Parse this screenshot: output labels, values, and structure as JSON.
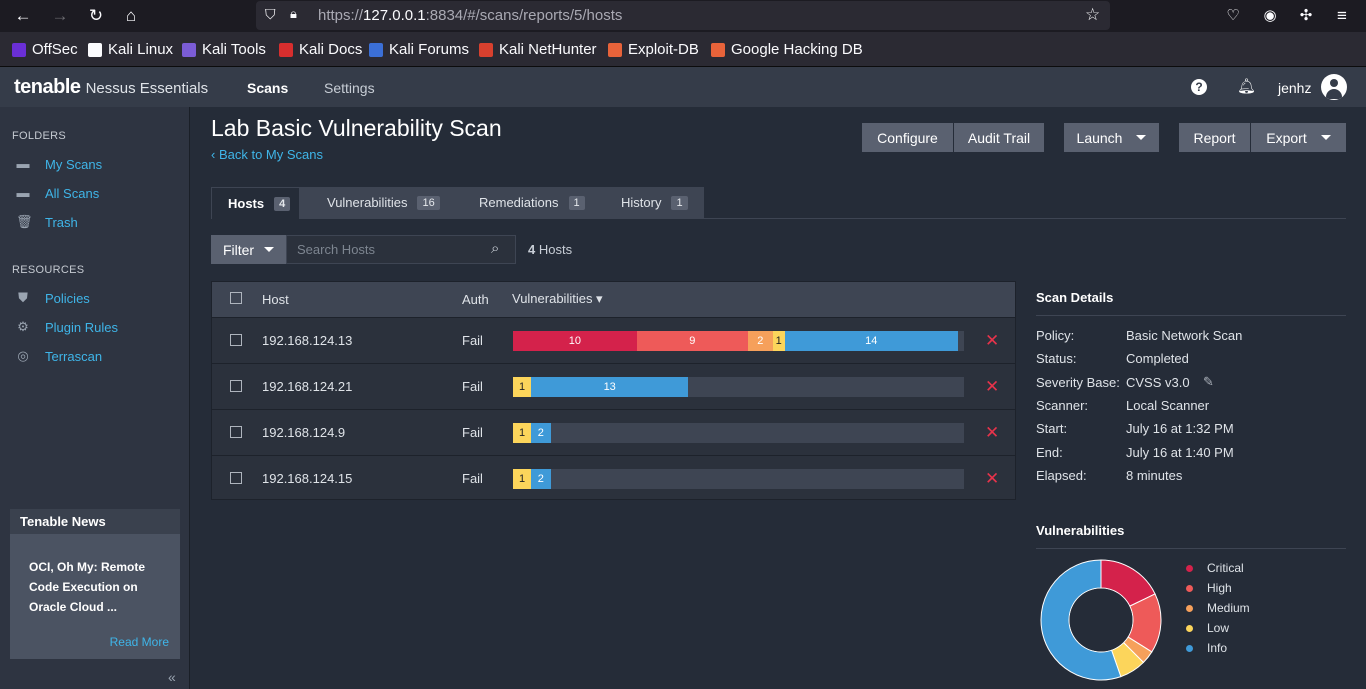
{
  "browser": {
    "url_prefix": "https://",
    "url_host": "127.0.0.1",
    "url_rest": ":8834/#/scans/reports/5/hosts"
  },
  "bookmarks": [
    {
      "label": "OffSec",
      "color": "#6a2fd6"
    },
    {
      "label": "Kali Linux",
      "color": "#fbfbfe"
    },
    {
      "label": "Kali Tools",
      "color": "#7b5cd6"
    },
    {
      "label": "Kali Docs",
      "color": "#d82e2e"
    },
    {
      "label": "Kali Forums",
      "color": "#3b6fd6"
    },
    {
      "label": "Kali NetHunter",
      "color": "#d8402e"
    },
    {
      "label": "Exploit-DB",
      "color": "#e8633a"
    },
    {
      "label": "Google Hacking DB",
      "color": "#e8633a"
    }
  ],
  "app": {
    "logo": "tenable",
    "product": "Nessus Essentials",
    "nav_scans": "Scans",
    "nav_settings": "Settings",
    "user": "jenhz"
  },
  "sidebar": {
    "folders_title": "FOLDERS",
    "folders": [
      {
        "label": "My Scans",
        "icon": "folder-icon"
      },
      {
        "label": "All Scans",
        "icon": "folder-icon"
      },
      {
        "label": "Trash",
        "icon": "trash-icon"
      }
    ],
    "resources_title": "RESOURCES",
    "resources": [
      {
        "label": "Policies",
        "icon": "shield-icon"
      },
      {
        "label": "Plugin Rules",
        "icon": "plugin-icon"
      },
      {
        "label": "Terrascan",
        "icon": "radar-icon"
      }
    ],
    "news_title": "Tenable News",
    "news_headline": "OCI, Oh My: Remote Code Execution on Oracle Cloud ...",
    "read_more": "Read More"
  },
  "scan": {
    "title": "Lab Basic Vulnerability Scan",
    "back_link": "Back to My Scans",
    "buttons": {
      "configure": "Configure",
      "audit_trail": "Audit Trail",
      "launch": "Launch",
      "report": "Report",
      "export": "Export"
    },
    "tabs": [
      {
        "label": "Hosts",
        "count": "4"
      },
      {
        "label": "Vulnerabilities",
        "count": "16"
      },
      {
        "label": "Remediations",
        "count": "1"
      },
      {
        "label": "History",
        "count": "1"
      }
    ],
    "filter_label": "Filter",
    "search_placeholder": "Search Hosts",
    "host_count": "4",
    "host_count_label": "Hosts"
  },
  "table": {
    "col_host": "Host",
    "col_auth": "Auth",
    "col_vulns": "Vulnerabilities ▾",
    "colors": {
      "critical": "#d4224b",
      "high": "#ee5a59",
      "medium": "#f6a05b",
      "low": "#fcd55b",
      "info": "#3f9ad8"
    },
    "rows": [
      {
        "host": "192.168.124.13",
        "auth": "Fail",
        "critical": 10,
        "high": 9,
        "medium": 2,
        "low": 1,
        "info": 14
      },
      {
        "host": "192.168.124.21",
        "auth": "Fail",
        "critical": 0,
        "high": 0,
        "medium": 0,
        "low": 1,
        "info": 13
      },
      {
        "host": "192.168.124.9",
        "auth": "Fail",
        "critical": 0,
        "high": 0,
        "medium": 0,
        "low": 1,
        "info": 2
      },
      {
        "host": "192.168.124.15",
        "auth": "Fail",
        "critical": 0,
        "high": 0,
        "medium": 0,
        "low": 1,
        "info": 2
      }
    ]
  },
  "details": {
    "title": "Scan Details",
    "items": [
      {
        "label": "Policy:",
        "value": "Basic Network Scan"
      },
      {
        "label": "Status:",
        "value": "Completed"
      },
      {
        "label": "Severity Base:",
        "value": "CVSS v3.0"
      },
      {
        "label": "Scanner:",
        "value": "Local Scanner"
      },
      {
        "label": "Start:",
        "value": "July 16 at 1:32 PM"
      },
      {
        "label": "End:",
        "value": "July 16 at 1:40 PM"
      },
      {
        "label": "Elapsed:",
        "value": "8 minutes"
      }
    ]
  },
  "chart_data": {
    "type": "pie",
    "title": "Vulnerabilities",
    "categories": [
      "Critical",
      "High",
      "Medium",
      "Low",
      "Info"
    ],
    "values": [
      10,
      9,
      2,
      4,
      31
    ],
    "colors": [
      "#d4224b",
      "#ee5a59",
      "#f6a05b",
      "#fcd55b",
      "#3f9ad8"
    ]
  }
}
